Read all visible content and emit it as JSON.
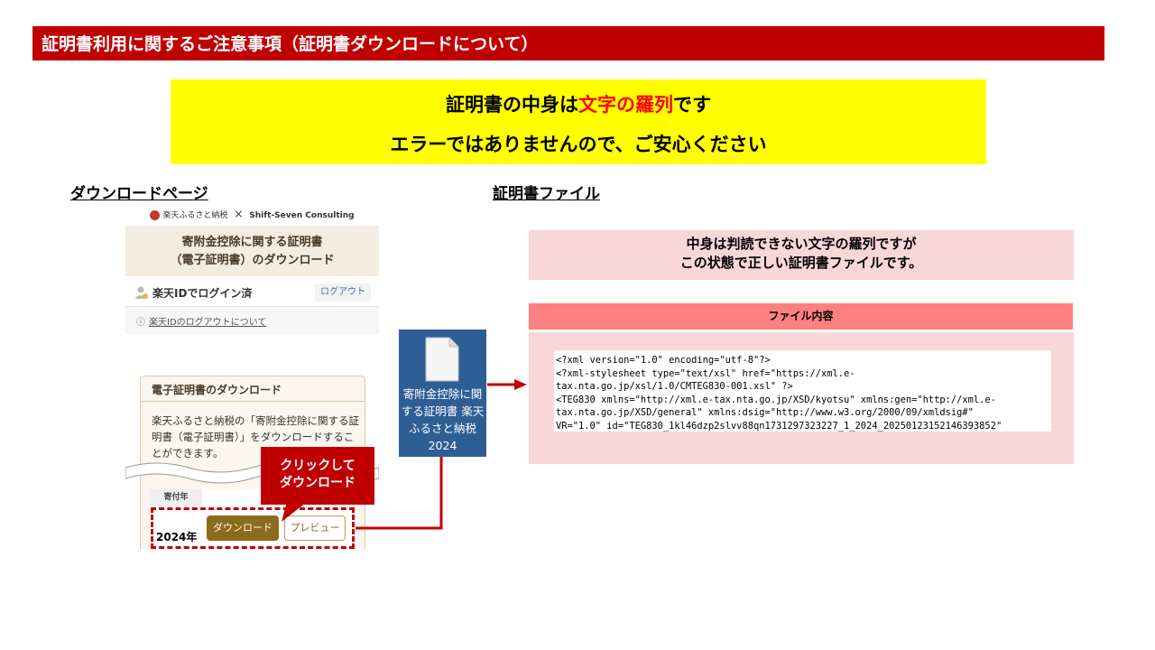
{
  "title": "証明書利用に関するご注意事項（証明書ダウンロードについて）",
  "notice": {
    "line1_prefix": "証明書の中身は",
    "line1_emphasis": "文字の羅列",
    "line1_suffix": "です",
    "line2": "エラーではありませんので、ご安心ください"
  },
  "left_heading": "ダウンロードページ",
  "right_heading": "証明書ファイル",
  "download_page": {
    "logo_text": "楽天ふるさと納税",
    "logo_cross": "×",
    "partner": "Shift-Seven Consulting",
    "header_line1": "寄附金控除に関する証明書",
    "header_line2": "（電子証明書）のダウンロード",
    "login_status": "楽天IDでログイン済",
    "logout_button": "ログアウト",
    "info_icon": "ⓘ",
    "info_link": "楽天IDのログアウトについて",
    "card_title": "電子証明書のダウンロード",
    "card_body": "楽天ふるさと納税の「寄附金控除に関する証明書（電子証明書）」をダウンロードすることができます。",
    "year_header": "寄付年",
    "year_value": "2024年",
    "download_button": "ダウンロード",
    "preview_button": "プレビュー"
  },
  "callout": {
    "line1": "クリックして",
    "line2": "ダウンロード"
  },
  "file_icon": {
    "label": "寄附金控除に関する証明書 楽天ふるさと納税 2024"
  },
  "explanation": {
    "line1": "中身は判読できない文字の羅列ですが",
    "line2": "この状態で正しい証明書ファイルです。"
  },
  "file_content": {
    "header": "ファイル内容",
    "code": "<?xml version=\"1.0\" encoding=\"utf-8\"?>\n<?xml-stylesheet type=\"text/xsl\" href=\"https://xml.e-\ntax.nta.go.jp/xsl/1.0/CMTEG830-001.xsl\" ?>\n<TEG830 xmlns=\"http://xml.e-tax.nta.go.jp/XSD/kyotsu\" xmlns:gen=\"http://xml.e-\ntax.nta.go.jp/XSD/general\" xmlns:dsig=\"http://www.w3.org/2000/09/xmldsig#\"\nVR=\"1.0\" id=\"TEG830_1kl46dzp2slvv88qn1731297323227_1_2024_20250123152146393852\""
  },
  "colors": {
    "title_bar": "#c00000",
    "notice_bg": "#ffff00",
    "emphasis": "#ff0000",
    "pink_bg": "#f8d7d6",
    "file_header_bg": "#ff8080",
    "download_button": "#8e6a1c",
    "file_tile": "#2e5f94"
  },
  "icons": [
    "seal-icon",
    "person-icon",
    "info-icon",
    "document-icon",
    "arrow-icon"
  ]
}
